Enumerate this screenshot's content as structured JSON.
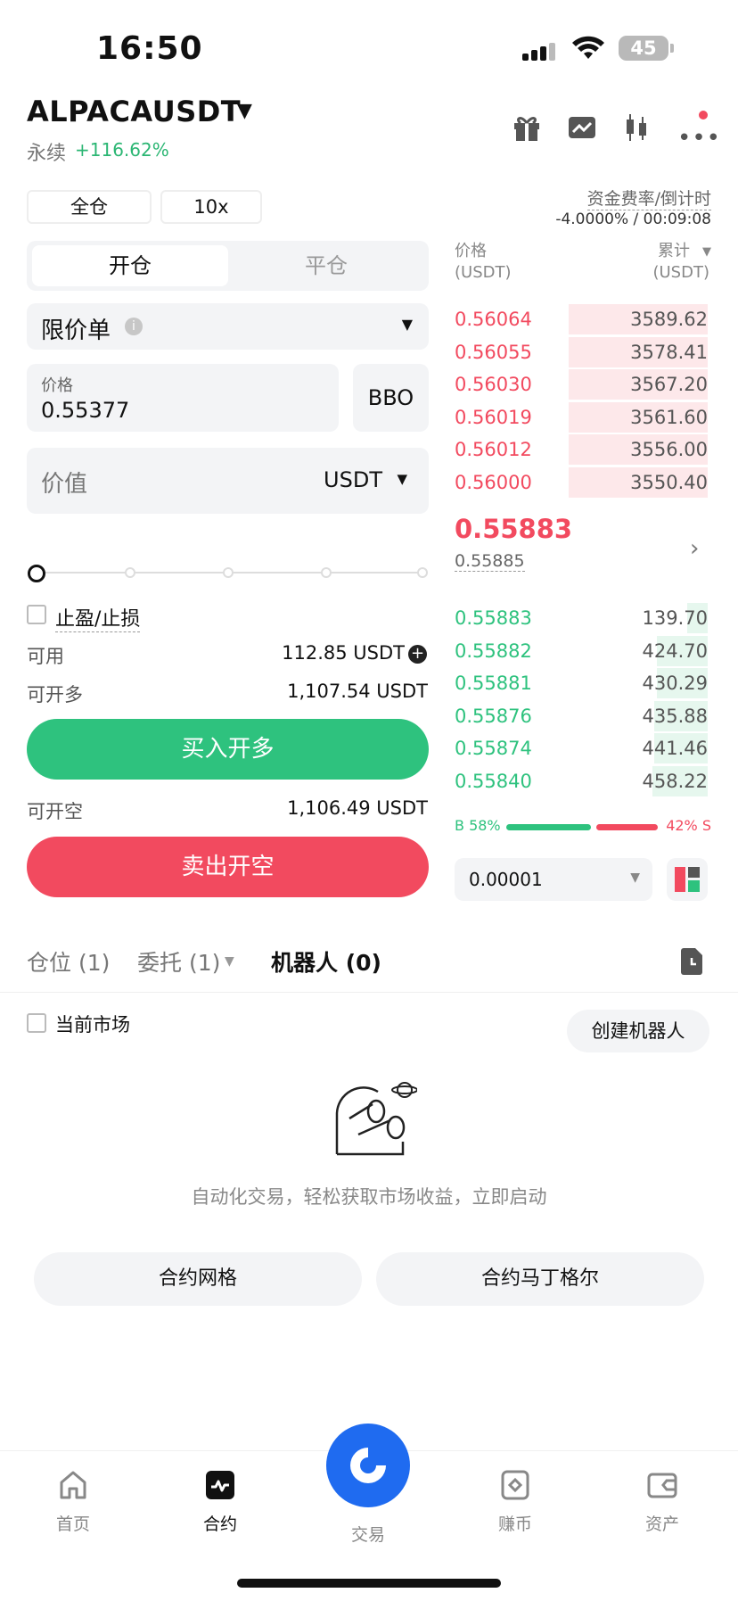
{
  "status_bar": {
    "time": "16:50",
    "battery": "45"
  },
  "header": {
    "symbol": "ALPACAUSDT",
    "contract_type": "永续",
    "change_pct": "+116.62%",
    "icons": [
      "gift-icon",
      "chart-exchange-icon",
      "candlestick-icon",
      "more-icon"
    ]
  },
  "controls": {
    "margin_mode": "全仓",
    "leverage": "10x",
    "funding_label": "资金费率/倒计时",
    "funding_value": "-4.0000% / 00:09:08"
  },
  "order_form": {
    "tab_open": "开仓",
    "tab_close": "平仓",
    "order_type": "限价单",
    "price_label": "价格",
    "price_value": "0.55377",
    "bbo": "BBO",
    "value_label": "价值",
    "value_unit": "USDT",
    "slider_pct": 0,
    "tpsl": "止盈/止损",
    "available_label": "可用",
    "available_value": "112.85 USDT",
    "can_long_label": "可开多",
    "can_long_value": "1,107.54 USDT",
    "buy_button": "买入开多",
    "can_short_label": "可开空",
    "can_short_value": "1,106.49 USDT",
    "sell_button": "卖出开空"
  },
  "orderbook": {
    "price_header": "价格",
    "price_unit": "(USDT)",
    "sum_header": "累计",
    "sum_unit": "(USDT)",
    "asks": [
      {
        "price": "0.56064",
        "qty": "3589.62",
        "depth": 0.55
      },
      {
        "price": "0.56055",
        "qty": "3578.41",
        "depth": 0.55
      },
      {
        "price": "0.56030",
        "qty": "3567.20",
        "depth": 0.55
      },
      {
        "price": "0.56019",
        "qty": "3561.60",
        "depth": 0.55
      },
      {
        "price": "0.56012",
        "qty": "3556.00",
        "depth": 0.55
      },
      {
        "price": "0.56000",
        "qty": "3550.40",
        "depth": 0.55
      }
    ],
    "last_price": "0.55883",
    "mark_price": "0.55885",
    "bids": [
      {
        "price": "0.55883",
        "qty": "139.70",
        "depth": 0.08
      },
      {
        "price": "0.55882",
        "qty": "424.70",
        "depth": 0.2
      },
      {
        "price": "0.55881",
        "qty": "430.29",
        "depth": 0.2
      },
      {
        "price": "0.55876",
        "qty": "435.88",
        "depth": 0.21
      },
      {
        "price": "0.55874",
        "qty": "441.46",
        "depth": 0.21
      },
      {
        "price": "0.55840",
        "qty": "458.22",
        "depth": 0.22
      }
    ],
    "buy_ratio_label": "B 58%",
    "sell_ratio_label": "42% S",
    "buy_ratio": 0.58,
    "precision": "0.00001"
  },
  "tabs": {
    "positions": "仓位 (1)",
    "orders": "委托 (1)",
    "bots": "机器人 (0)"
  },
  "bots": {
    "current_market": "当前市场",
    "create_button": "创建机器人",
    "empty_text": "自动化交易，轻松获取市场收益，立即启动",
    "grid_button": "合约网格",
    "martingale_button": "合约马丁格尔"
  },
  "bottom_nav": {
    "home": "首页",
    "contract": "合约",
    "trade": "交易",
    "earn": "赚币",
    "assets": "资产"
  },
  "colors": {
    "green": "#2ec27e",
    "red": "#f24a5f",
    "blue": "#1f6bf0"
  }
}
